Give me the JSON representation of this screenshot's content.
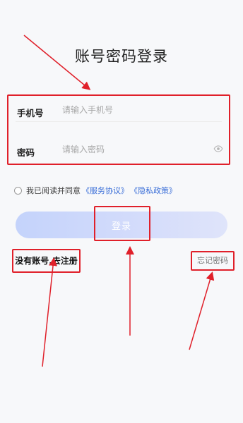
{
  "page": {
    "title": "账号密码登录"
  },
  "form": {
    "phone": {
      "label": "手机号",
      "placeholder": "请输入手机号",
      "value": ""
    },
    "password": {
      "label": "密码",
      "placeholder": "请输入密码",
      "value": ""
    },
    "eye_icon": "eye-icon"
  },
  "agreement": {
    "prefix": "我已阅读并同意",
    "service_link": "《服务协议》",
    "privacy_link": "《隐私政策》",
    "checked": false
  },
  "login": {
    "label": "登录"
  },
  "links": {
    "register": "没有账号,去注册",
    "forgot": "忘记密码"
  },
  "colors": {
    "annotation": "#e0202a",
    "link": "#3b6fd8",
    "button_gradient_start": "#c4d3fb",
    "button_gradient_end": "#dfe4fa",
    "background": "#f7f8fa"
  }
}
